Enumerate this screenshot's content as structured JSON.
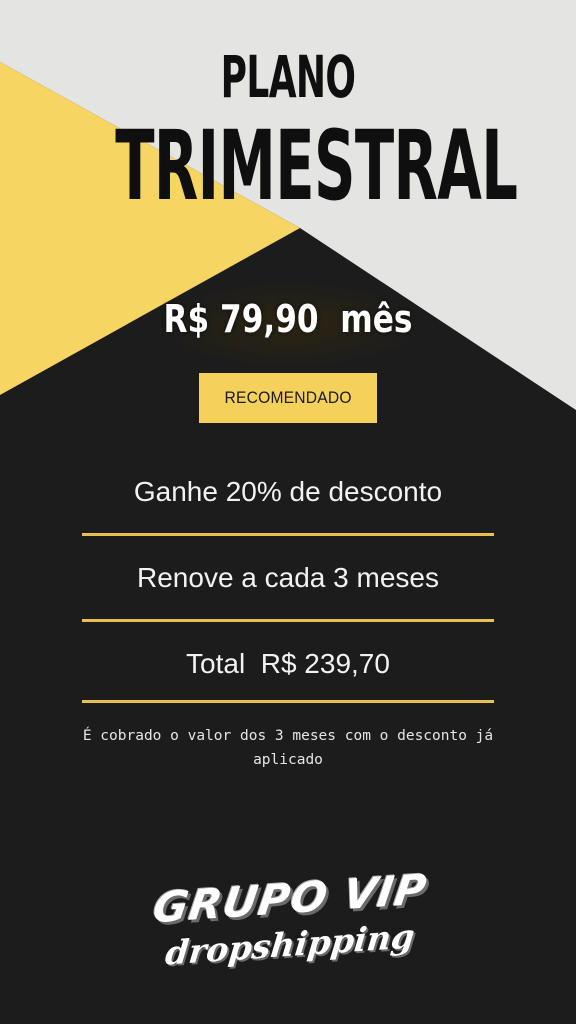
{
  "colors": {
    "background": "#1c1c1c",
    "light_panel": "#e4e4e2",
    "accent_yellow": "#f7d563",
    "divider": "#e8c04e",
    "text_light": "#f2f2f2"
  },
  "header": {
    "line1": "PLANO",
    "line2": "TRIMESTRAL"
  },
  "price": {
    "text": "R$ 79,90  mês"
  },
  "badge": {
    "label": "RECOMENDADO"
  },
  "features": [
    {
      "text": "Ganhe 20% de desconto"
    },
    {
      "text": "Renove a cada 3 meses"
    },
    {
      "text": "Total  R$ 239,70"
    }
  ],
  "note": {
    "text": "É cobrado o valor dos 3 meses com o desconto já aplicado"
  },
  "logo": {
    "line1": "GRUPO VIP",
    "line2": "dropshipping"
  }
}
